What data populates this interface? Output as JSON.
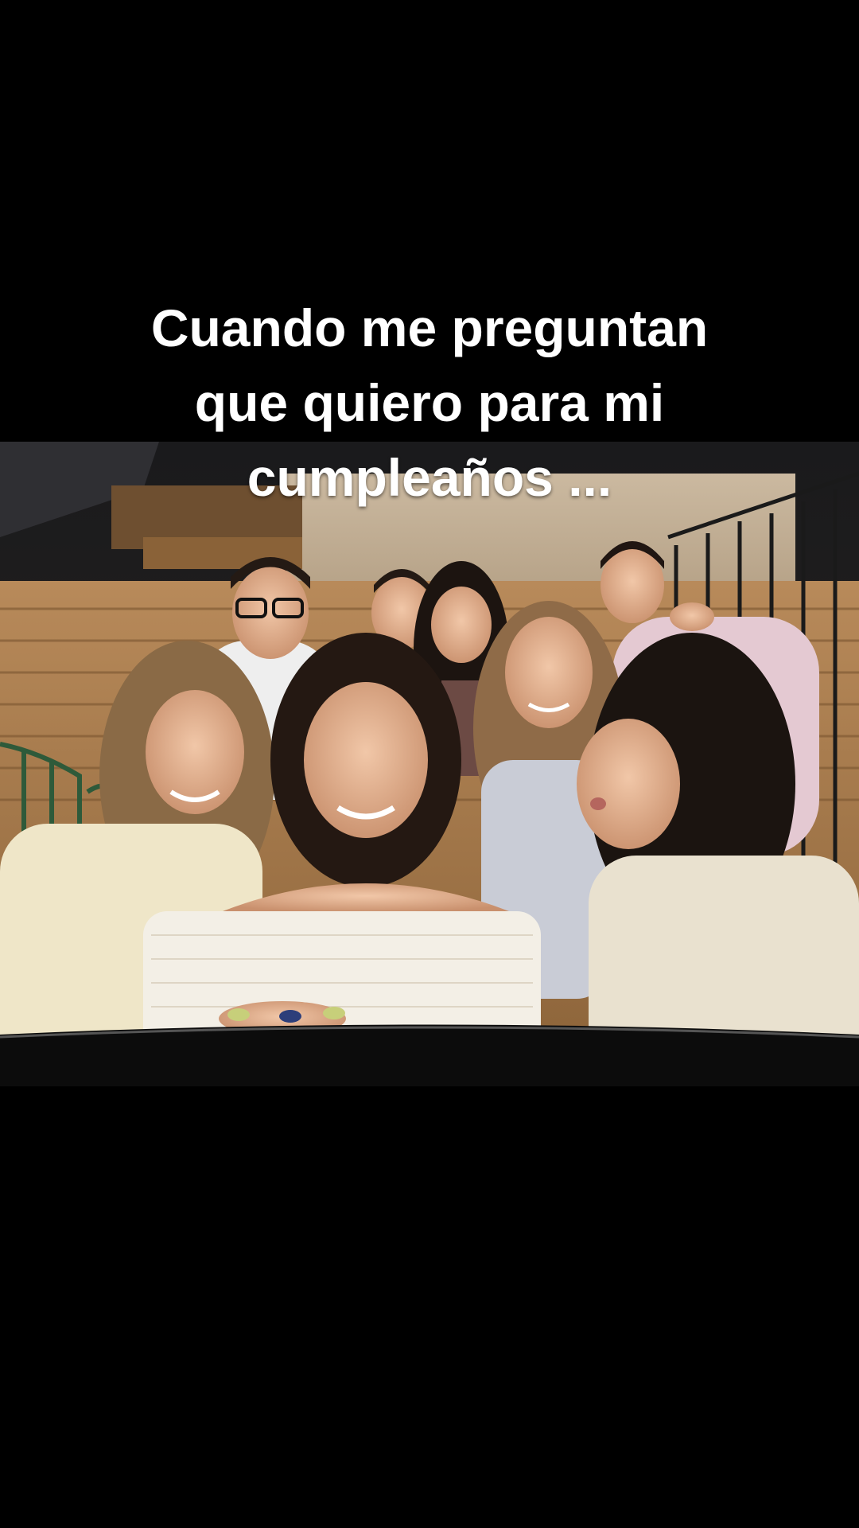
{
  "caption": {
    "lines": [
      "Cuando me preguntan",
      "que quiero para mi",
      "cumpleaños ..."
    ]
  },
  "photo": {
    "description_icon": "group-photo-image"
  }
}
